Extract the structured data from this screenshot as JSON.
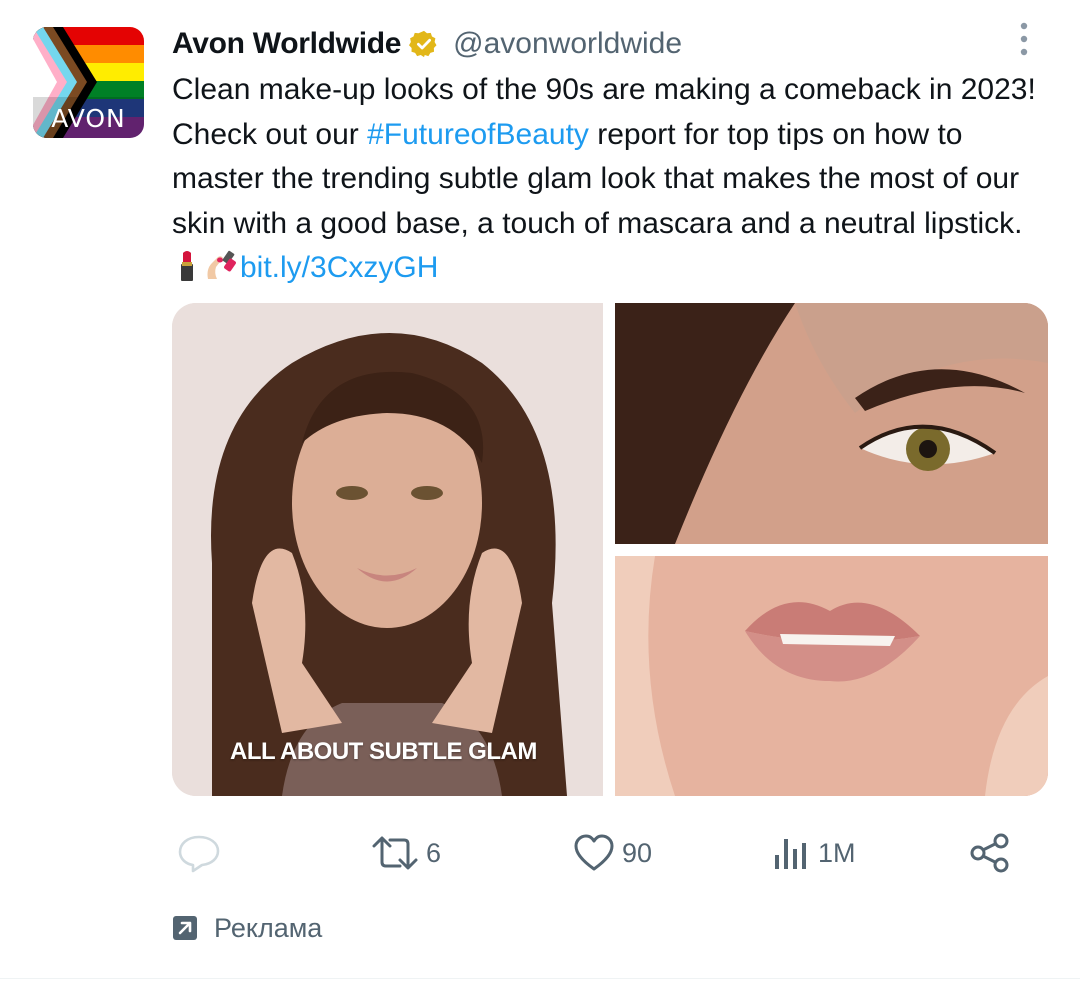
{
  "post": {
    "avatar_text": "AVON",
    "author_name": "Avon Worldwide",
    "handle": "@avonworldwide",
    "text_before_hashtag": "Clean make-up looks of the 90s are making a comeback in 2023! Check out our ",
    "hashtag": "#FutureofBeauty",
    "text_after_hashtag": " report for top tips on how to master the trending subtle glam look that makes the most of our skin with a good base, a touch of mascara and a neutral lipstick. ",
    "emojis": [
      "lipstick",
      "nail-polish"
    ],
    "link": "bit.ly/3CxzyGH"
  },
  "media": {
    "caption": "ALL ABOUT SUBTLE GLAM",
    "images": [
      "model-portrait",
      "eye-closeup",
      "lips-closeup"
    ]
  },
  "actions": {
    "reply_count": "",
    "retweet_count": "6",
    "like_count": "90",
    "views_count": "1M"
  },
  "ad_label": "Реклама",
  "colors": {
    "link": "#1d9bf0",
    "secondary_text": "#536471",
    "verified_badge": "#e2b719"
  }
}
